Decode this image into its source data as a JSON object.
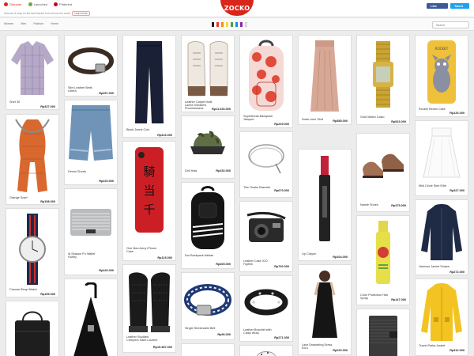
{
  "brand": "ZOCKO",
  "nav": {
    "discover": "Discover",
    "launched": "Launched",
    "pinterest": "Pinterest",
    "subtext": "Discover & shop for the best fashion from all over the world.",
    "chip": "Learn more"
  },
  "social": {
    "facebook": "Like",
    "twitter": "Tweet"
  },
  "categories": [
    "Women",
    "Men",
    "Fashion",
    "Home"
  ],
  "swatch_colors": [
    "#222222",
    "#e53935",
    "#fb8c00",
    "#fdd835",
    "#43a047",
    "#1e88e5",
    "#8e24aa",
    "#ffffff"
  ],
  "search": {
    "placeholder": "Search"
  },
  "products": [
    {
      "name": "Shirt 30",
      "price": "Rp337.000"
    },
    {
      "name": "Slim Leather Belts Libera",
      "price": "Rp257.000"
    },
    {
      "name": "Black Jeans Colo",
      "price": "Rp416.000"
    },
    {
      "name": "Leather Carpet Multi Laced Sneakers Pronimessera",
      "price": "Rp11.026.000"
    },
    {
      "name": "Superbreak Backpack Jetsport",
      "price": "Rp229.000"
    },
    {
      "name": "Nude color Skirt",
      "price": "Rp385.000"
    },
    {
      "name": "Gold Watch Casio",
      "price": "Rp523.000"
    },
    {
      "name": "Rocket Redmi Case",
      "price": "Rp126.000"
    },
    {
      "name": "Denim Shorts",
      "price": "Rp220.000"
    },
    {
      "name": "Drill Hats",
      "price": "Rp152.000"
    },
    {
      "name": "Thin Snake Bracelet",
      "price": "Rp679.000"
    },
    {
      "name": "Lip Crayon",
      "price": "Rp104.000"
    },
    {
      "name": "Namie Shoes",
      "price": "Rp375.000"
    },
    {
      "name": "Midi Circle Skirt Elite",
      "price": "Rp327.000"
    },
    {
      "name": "Orange Scarf",
      "price": "Rp158.000"
    },
    {
      "name": "One Man Army iPhone Case",
      "price": "Rp115.000"
    },
    {
      "name": "Leather Case X20 Fujifilm",
      "price": "Rp792.000"
    },
    {
      "name": "Dor Backpack Adidas",
      "price": "Rp405.000"
    },
    {
      "name": "Canvas Strap Watch",
      "price": "Rp159.000"
    },
    {
      "name": "Id Season Pu Wallet Hurley",
      "price": "Rp240.000"
    },
    {
      "name": "Color Protection Hair Spray",
      "price": "Rp147.000"
    },
    {
      "name": "Harness Jacket Snipes",
      "price": "Rp272.000"
    },
    {
      "name": "Leather Studded Creepers Saint Laurent",
      "price": "Rp15.387.000"
    },
    {
      "name": "Leather Bracelet with Clasp Wrap",
      "price": "Rp271.000"
    },
    {
      "name": "Lace Drawstring Dress Ecro",
      "price": "Rp220.000"
    },
    {
      "name": "Single Stretchable Belt",
      "price": "Rp96.000"
    },
    {
      "name": "Travel Parka Jacket",
      "price": "Rp312.000"
    }
  ]
}
